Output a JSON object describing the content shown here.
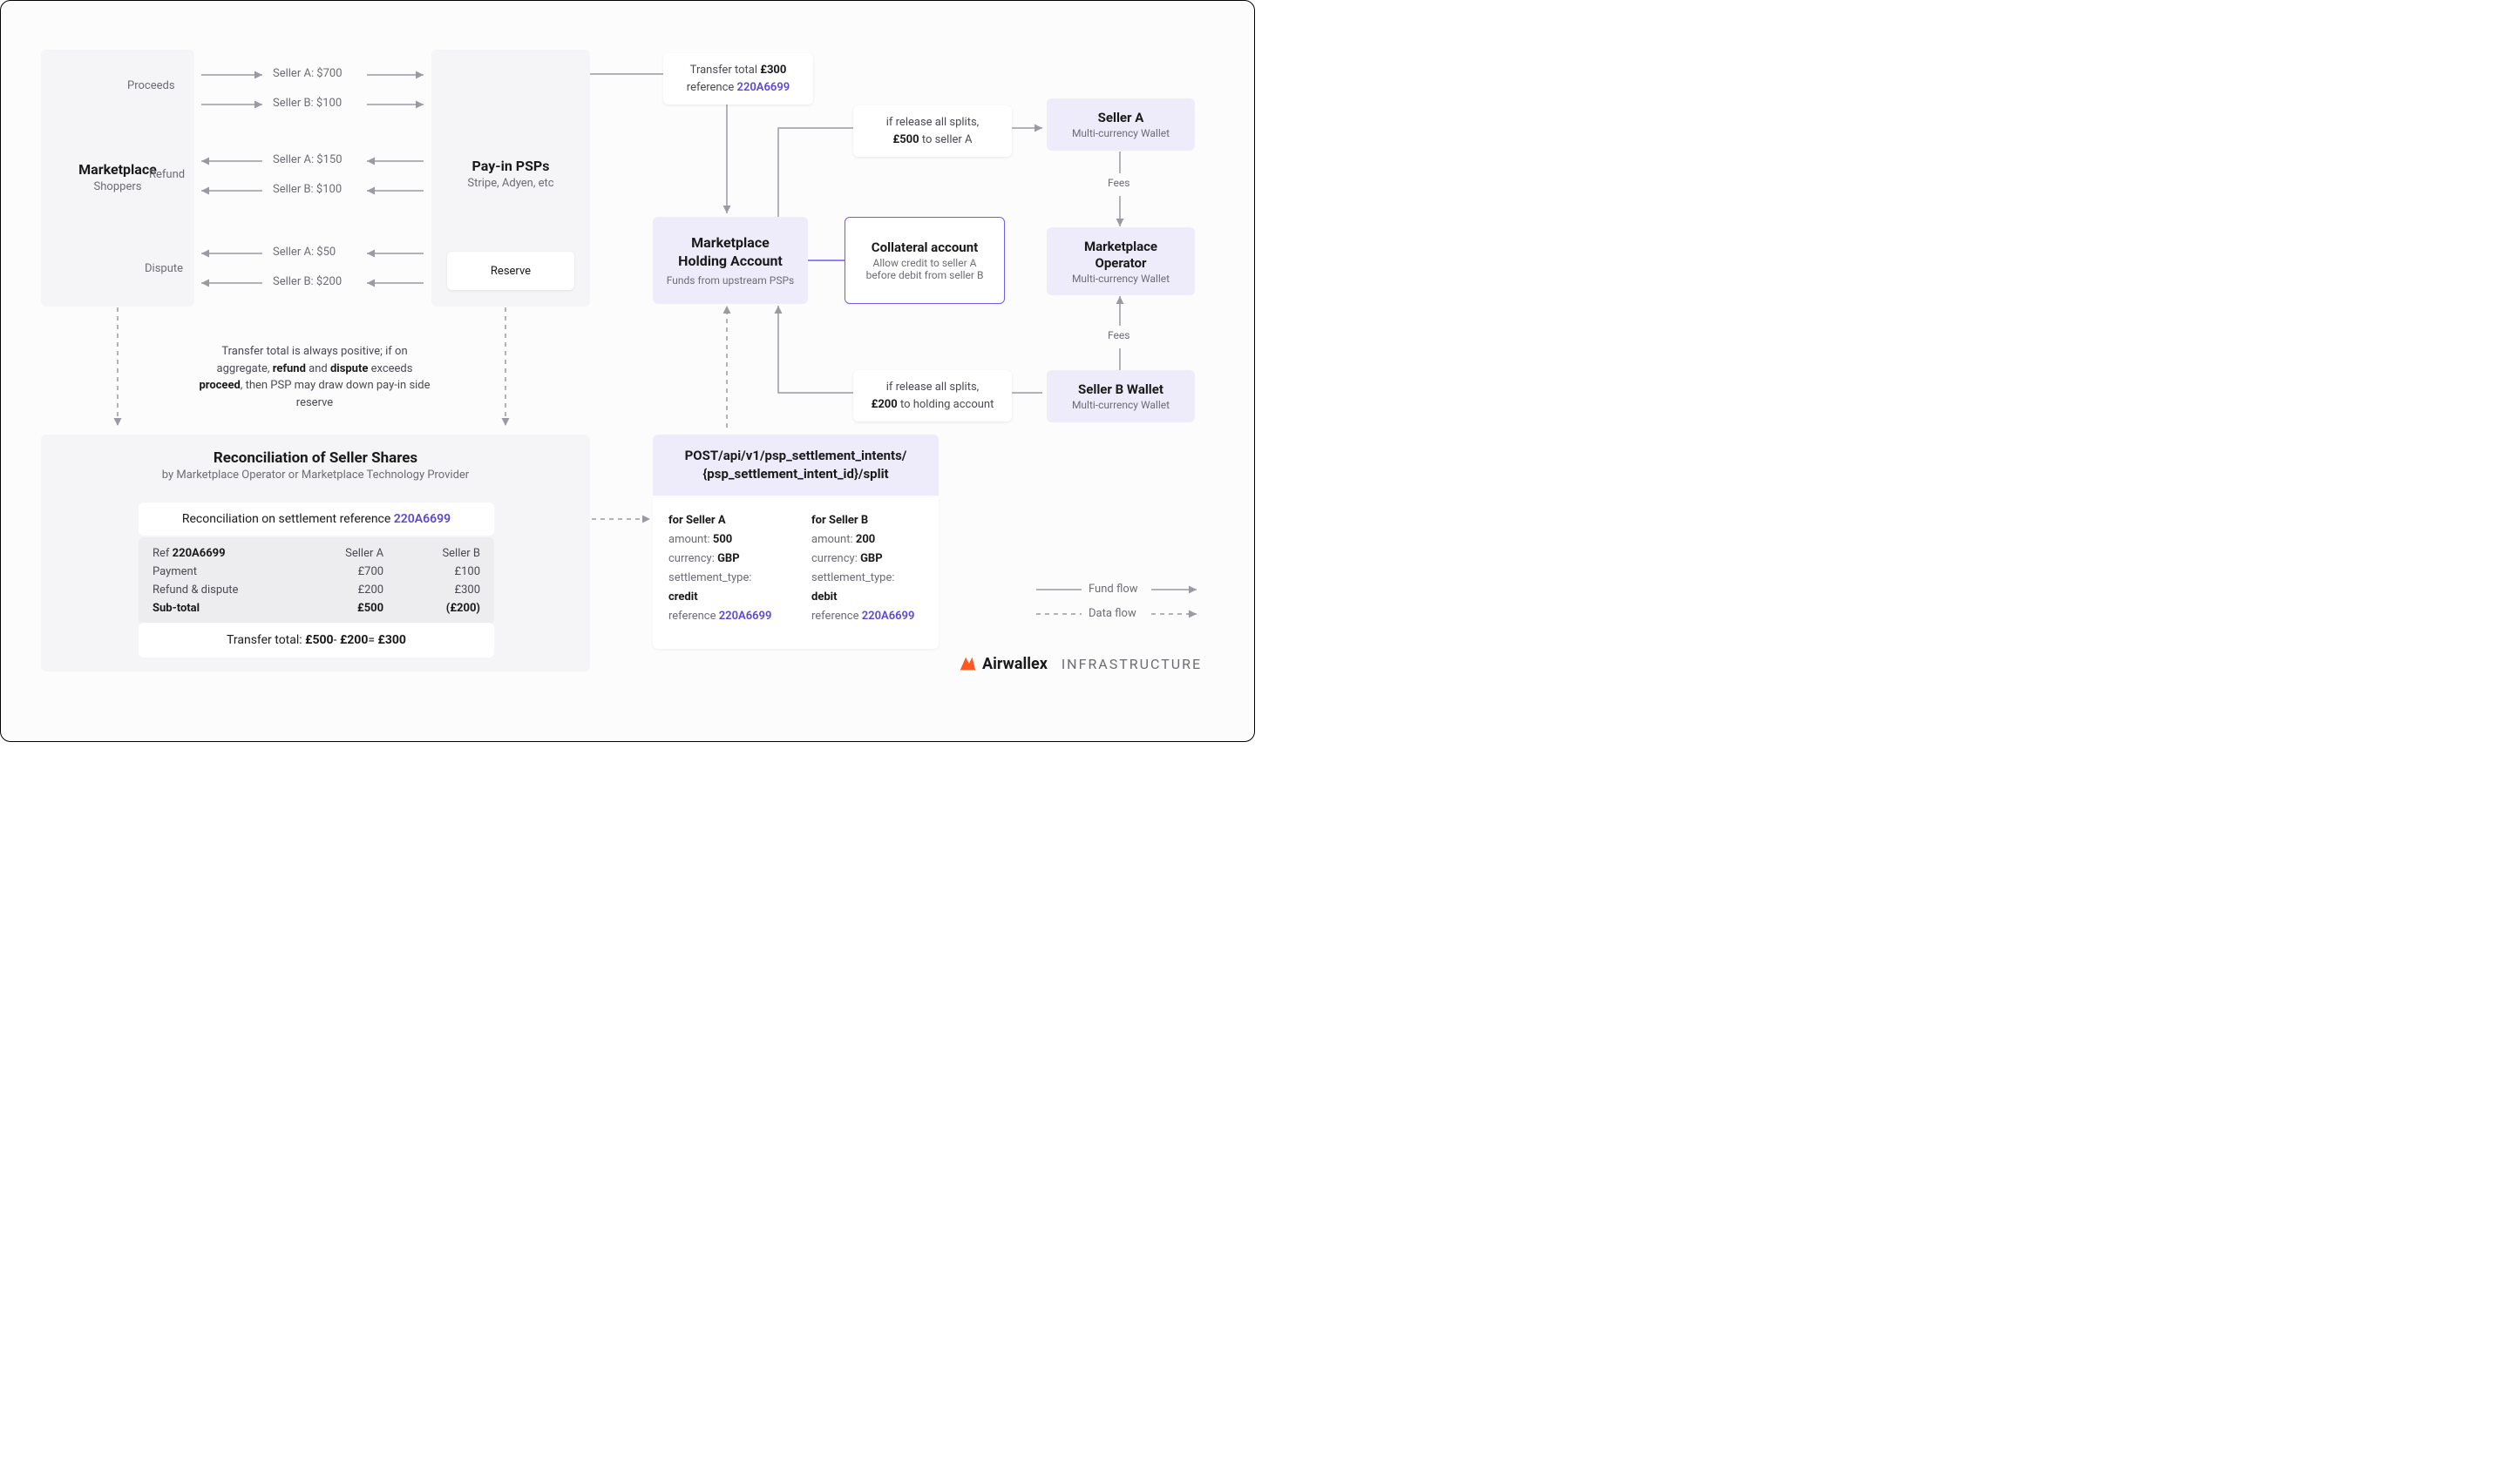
{
  "marketplace": {
    "title": "Marketplace",
    "sub": "Shoppers"
  },
  "proceeds_label": "Proceeds",
  "refund_label": "Refund",
  "dispute_label": "Dispute",
  "proceeds": {
    "a": "Seller A: $700",
    "b": "Seller B: $100"
  },
  "refund": {
    "a": "Seller A: $150",
    "b": "Seller B: $100"
  },
  "dispute": {
    "a": "Seller A: $50",
    "b": "Seller B: $200"
  },
  "psp": {
    "title": "Pay-in PSPs",
    "sub": "Stripe, Adyen, etc",
    "reserve": "Reserve"
  },
  "note1_pre": "Transfer total is always positive; if on aggregate,",
  "note1_bold1": "refund",
  "note1_mid1": " and ",
  "note1_bold2": "dispute",
  "note1_mid2": " exceeds ",
  "note1_bold3": "proceed",
  "note1_post": ", then PSP may draw down pay-in side reserve",
  "recon": {
    "title": "Reconciliation of Seller Shares",
    "sub": "by Marketplace Operator or Marketplace Technology Provider",
    "refbar_pre": "Reconciliation on settlement reference ",
    "refbar_ref": "220A6699",
    "table": {
      "rows": [
        {
          "c1_pre": "Ref ",
          "c1_bold": "220A6699",
          "c2": "Seller A",
          "c3": "Seller B"
        },
        {
          "c1": "Payment",
          "c2": "£700",
          "c3": "£100"
        },
        {
          "c1": "Refund & dispute",
          "c2": "£200",
          "c3": "£300"
        },
        {
          "c1": "Sub-total",
          "c2": "£500",
          "c3": "(£200)",
          "bold": true
        }
      ]
    },
    "transfer_label": "Transfer total:",
    "transfer_a": "£500",
    "transfer_minus": " - ",
    "transfer_b": "£200",
    "transfer_eq": " = ",
    "transfer_total": "£300"
  },
  "transfer_note_pre": "Transfer total ",
  "transfer_note_amt": "£300",
  "transfer_note_ref_pre": "reference ",
  "transfer_note_ref": "220A6699",
  "holding": {
    "title1": "Marketplace",
    "title2": "Holding Account",
    "sub": "Funds from upstream PSPs"
  },
  "collateral": {
    "title": "Collateral account",
    "sub1": "Allow credit to seller A",
    "sub2": "before debit from seller B"
  },
  "splitA_pre": "if release all splits,",
  "splitA_amt": "£500",
  "splitA_post": " to seller A",
  "splitB_pre": "if release all splits,",
  "splitB_amt": "£200",
  "splitB_post": " to holding account",
  "sellerA": {
    "title": "Seller A",
    "sub": "Multi-currency Wallet"
  },
  "operator": {
    "title1": "Marketplace",
    "title2": "Operator",
    "sub": "Multi-currency Wallet"
  },
  "sellerB": {
    "title": "Seller B Wallet",
    "sub": "Multi-currency Wallet"
  },
  "fees": "Fees",
  "api": {
    "line1": "POST/api/v1/psp_settlement_intents/",
    "line2": "{psp_settlement_intent_id}/split",
    "A": {
      "for": "for Seller A",
      "amount_l": "amount: ",
      "amount_v": "500",
      "curr_l": "currency: ",
      "curr_v": "GBP",
      "st_l": "settlement_type:",
      "st_v": "credit",
      "ref_l": "reference ",
      "ref_v": "220A6699"
    },
    "B": {
      "for": "for Seller B",
      "amount_l": "amount: ",
      "amount_v": "200",
      "curr_l": "currency: ",
      "curr_v": "GBP",
      "st_l": "settlement_type:",
      "st_v": "debit",
      "ref_l": "reference ",
      "ref_v": "220A6699"
    }
  },
  "legend": {
    "fund": "Fund flow",
    "data": "Data flow"
  },
  "brand": "Airwallex",
  "infra": "INFRASTRUCTURE"
}
